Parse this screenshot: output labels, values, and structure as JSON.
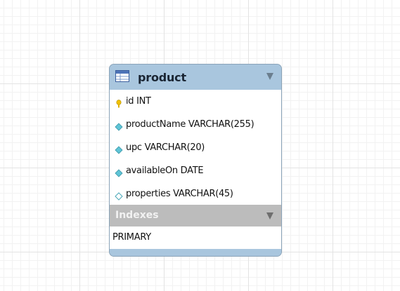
{
  "table": {
    "name": "product",
    "columns": [
      {
        "icon": "primary-key-icon",
        "label": "id INT"
      },
      {
        "icon": "column-diamond-filled-icon",
        "label": "productName VARCHAR(255)"
      },
      {
        "icon": "column-diamond-filled-icon",
        "label": "upc VARCHAR(20)"
      },
      {
        "icon": "column-diamond-filled-icon",
        "label": "availableOn DATE"
      },
      {
        "icon": "column-diamond-outline-icon",
        "label": "properties VARCHAR(45)"
      }
    ],
    "indexes_title": "Indexes",
    "indexes": [
      "PRIMARY"
    ]
  },
  "colors": {
    "header": "#a9c6de",
    "indexes_header": "#bcbcbc",
    "key_icon": "#f2c200",
    "column_icon": "#5fc4d6"
  }
}
